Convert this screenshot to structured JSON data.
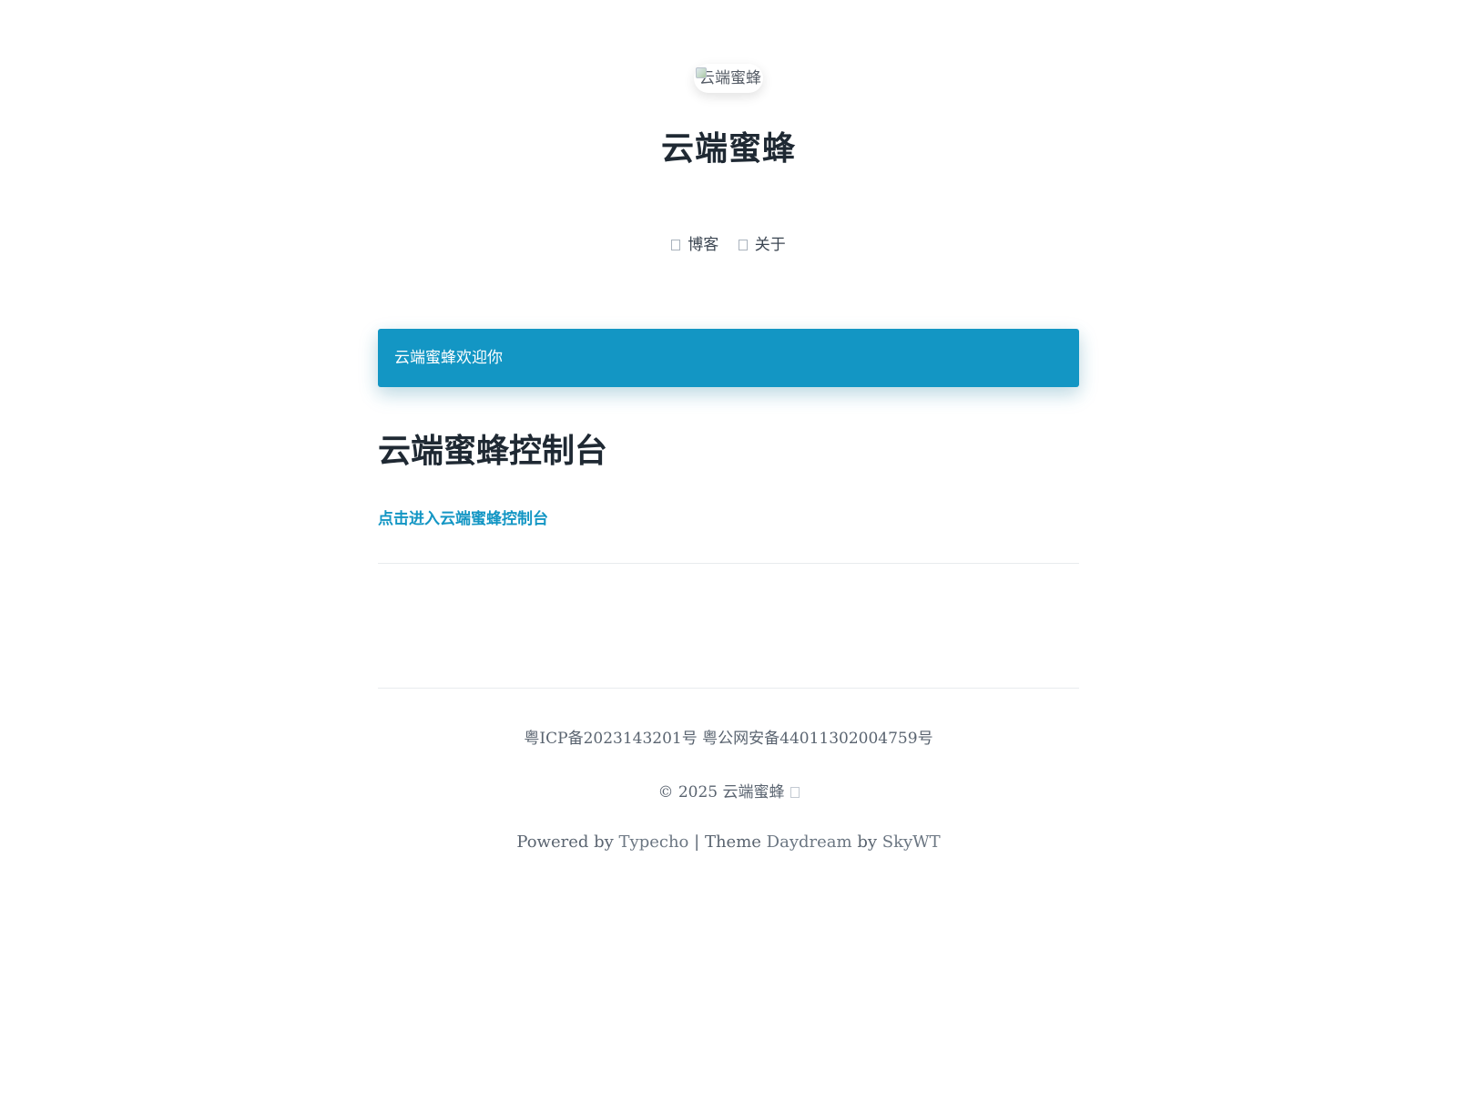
{
  "header": {
    "avatar_alt": "云端蜜蜂",
    "site_title": "云端蜜蜂",
    "nav": [
      {
        "label": "博客",
        "icon": "blog-icon"
      },
      {
        "label": "关于",
        "icon": "about-icon"
      }
    ]
  },
  "notice": {
    "text": "云端蜜蜂欢迎你",
    "background": "#1396c4"
  },
  "post": {
    "title": "云端蜜蜂控制台",
    "link_text": "点击进入云端蜜蜂控制台",
    "link_color": "#1396c4"
  },
  "footer": {
    "icp": "粤ICP备2023143201号 粤公网安备44011302004759号",
    "copyright": "© 2025 云端蜜蜂",
    "powered_prefix": "Powered by",
    "powered_engine": "Typecho",
    "separator": "|",
    "theme_prefix": "Theme",
    "theme_name": "Daydream",
    "by": "by",
    "theme_author": "SkyWT"
  }
}
